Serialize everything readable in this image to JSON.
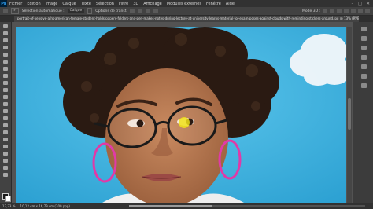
{
  "app": {
    "logo": "Ps"
  },
  "menu": [
    "Fichier",
    "Edition",
    "Image",
    "Calque",
    "Texte",
    "Sélection",
    "Filtre",
    "3D",
    "Affichage",
    "Modules externes",
    "Fenêtre",
    "Aide"
  ],
  "options": {
    "mode_label": "Sélection automatique :",
    "mode_value": "Calque",
    "transform_label": "Options de transf.",
    "mode3d_label": "Mode 3D :"
  },
  "document_tab": "portrait-of-pensive-afro-american-female-student-holds-papers-folders-and-pen-makes-notes-during-lecture-at-university-learns-material-for-exam-poses-against-clouds-with-reminding-stickers-around.jpg @ 13% (RVB/8)",
  "status": {
    "zoom": "13,33 %",
    "doc_info": "10,12 cm x 16,79 cm (300 ppp)",
    "progress": 0.35
  },
  "colors": {
    "sky": "#38b6e2",
    "earring": "#e03aa7",
    "cursor": "#f0e01a"
  }
}
